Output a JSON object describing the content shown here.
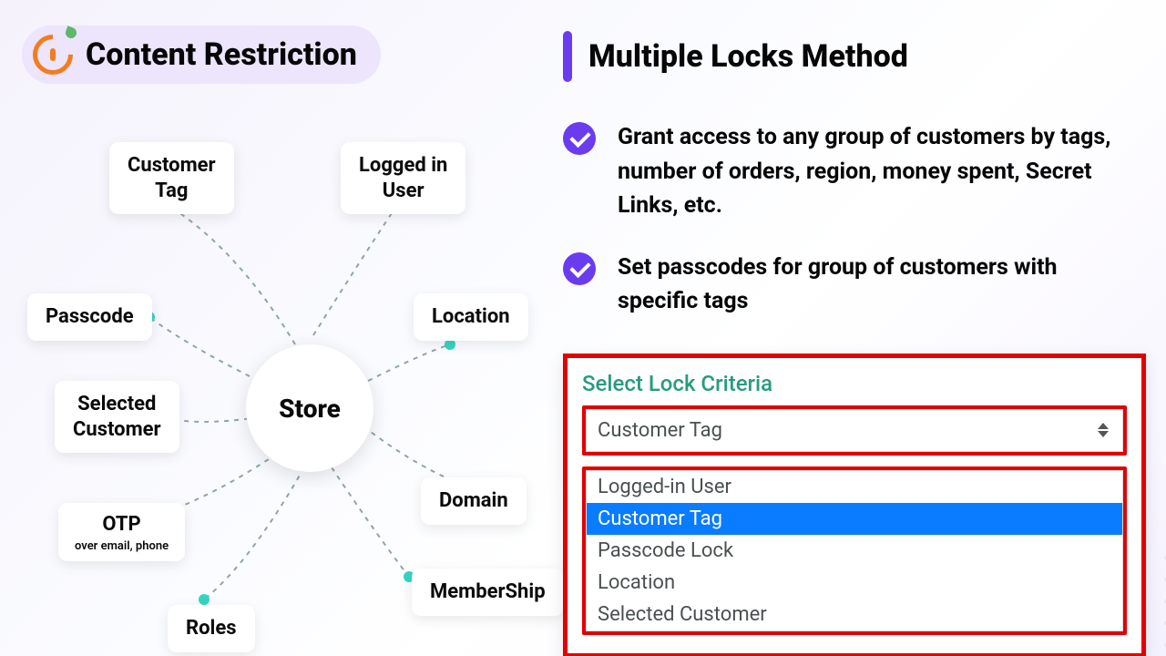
{
  "left": {
    "badge_title": "Content Restriction",
    "store_label": "Store",
    "nodes": {
      "customer_tag": "Customer\nTag",
      "logged_in_user": "Logged in\nUser",
      "passcode": "Passcode",
      "location": "Location",
      "selected_customer": "Selected\nCustomer",
      "domain": "Domain",
      "otp": "OTP",
      "otp_sub": "over email, phone",
      "roles": "Roles",
      "membership": "MemberShip"
    }
  },
  "right": {
    "heading": "Multiple Locks Method",
    "bullets": [
      "Grant access to any group of customers by tags, number of orders, region, money spent, Secret Links, etc.",
      "Set passcodes for group of customers with specific tags"
    ],
    "panel": {
      "label": "Select Lock Criteria",
      "selected": "Customer Tag",
      "options": [
        "Logged-in User",
        "Customer Tag",
        "Passcode Lock",
        "Location",
        "Selected Customer"
      ],
      "highlighted_index": 1
    }
  },
  "colors": {
    "accent_purple": "#6b3bf0",
    "accent_teal": "#35d3c3",
    "accent_red": "#e30000",
    "accent_orange": "#f47c20",
    "panel_label_green": "#279b7f",
    "option_highlight_blue": "#0a7cff"
  }
}
